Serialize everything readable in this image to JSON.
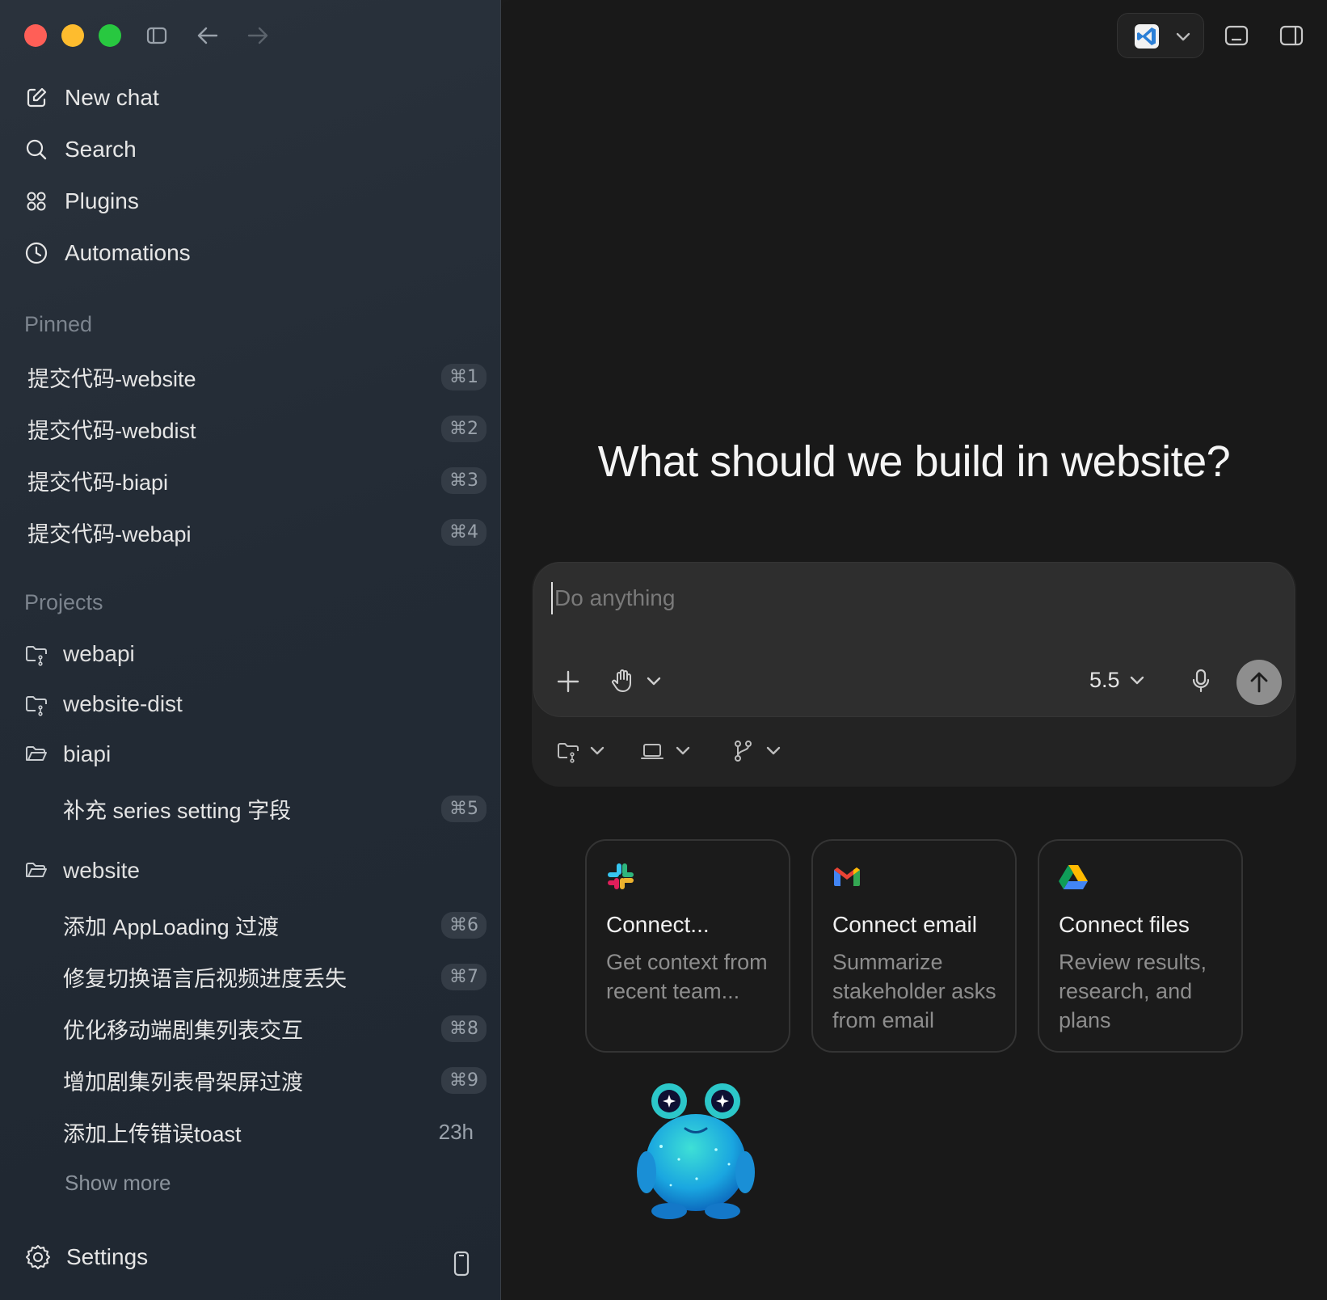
{
  "window": {
    "headline": "What should we build in website?"
  },
  "sidebar": {
    "nav": [
      {
        "label": "New chat",
        "icon": "edit-icon"
      },
      {
        "label": "Search",
        "icon": "search-icon"
      },
      {
        "label": "Plugins",
        "icon": "grid-icon"
      },
      {
        "label": "Automations",
        "icon": "clock-icon"
      }
    ],
    "pinned_label": "Pinned",
    "pinned": [
      {
        "label": "提交代码-website",
        "shortcut": "⌘1"
      },
      {
        "label": "提交代码-webdist",
        "shortcut": "⌘2"
      },
      {
        "label": "提交代码-biapi",
        "shortcut": "⌘3"
      },
      {
        "label": "提交代码-webapi",
        "shortcut": "⌘4"
      }
    ],
    "projects_label": "Projects",
    "projects": [
      {
        "name": "webapi"
      },
      {
        "name": "website-dist"
      },
      {
        "name": "biapi",
        "threads": [
          {
            "label": "补充 series setting 字段",
            "shortcut": "⌘5"
          }
        ]
      },
      {
        "name": "website",
        "threads": [
          {
            "label": "添加 AppLoading 过渡",
            "shortcut": "⌘6"
          },
          {
            "label": "修复切换语言后视频进度丢失",
            "shortcut": "⌘7"
          },
          {
            "label": "优化移动端剧集列表交互",
            "shortcut": "⌘8"
          },
          {
            "label": "增加剧集列表骨架屏过渡",
            "shortcut": "⌘9"
          },
          {
            "label": "添加上传错误toast",
            "time": "23h"
          }
        ]
      }
    ],
    "show_more": "Show more",
    "settings": "Settings"
  },
  "composer": {
    "placeholder": "Do anything",
    "value": "",
    "model": "5.5"
  },
  "cards": [
    {
      "title": "Connect...",
      "desc": "Get context from recent team...",
      "icon": "slack-icon"
    },
    {
      "title": "Connect email",
      "desc": "Summarize stakeholder asks from email",
      "icon": "gmail-icon"
    },
    {
      "title": "Connect files",
      "desc": "Review results, research, and plans",
      "icon": "google-drive-icon"
    }
  ],
  "colors": {
    "accent_red": "#ff5f57",
    "accent_yellow": "#febc2e",
    "accent_green": "#28c840",
    "vscode_blue": "#2b7fd6"
  }
}
